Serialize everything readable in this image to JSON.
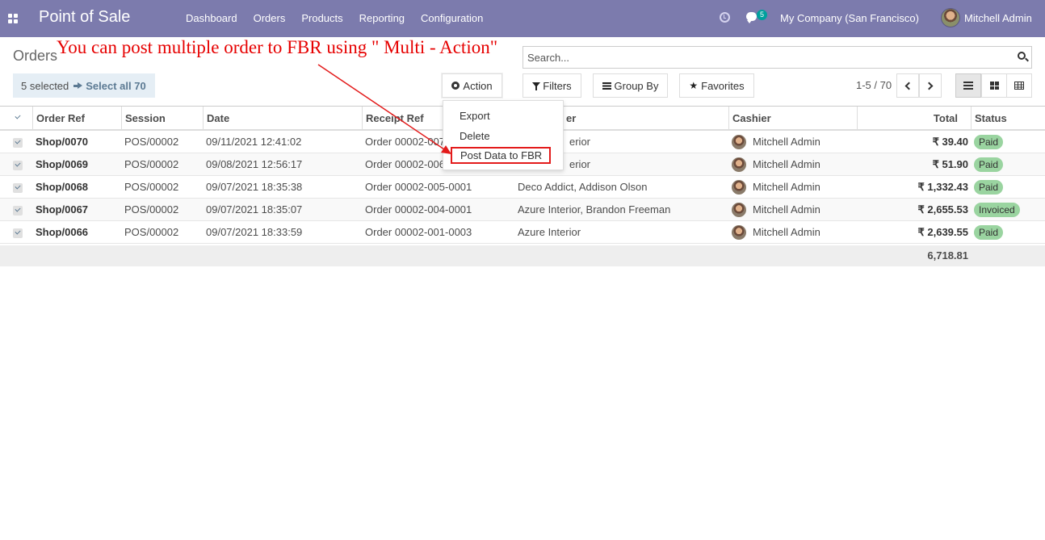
{
  "navbar": {
    "app_title": "Point of Sale",
    "menu": [
      "Dashboard",
      "Orders",
      "Products",
      "Reporting",
      "Configuration"
    ],
    "chat_count": "5",
    "company": "My Company (San Francisco)",
    "user": "Mitchell Admin"
  },
  "control_panel": {
    "breadcrumb": "Orders",
    "annotation": "You can post multiple order to FBR using \" Multi - Action\"",
    "search_placeholder": "Search...",
    "selected_text": "5 selected",
    "select_all": "Select all 70",
    "action_label": "Action",
    "filters_label": "Filters",
    "groupby_label": "Group By",
    "favorites_label": "Favorites",
    "pager": "1-5 / 70"
  },
  "action_menu": {
    "export": "Export",
    "delete": "Delete",
    "post_fbr": "Post Data to FBR"
  },
  "table": {
    "columns": {
      "order_ref": "Order Ref",
      "session": "Session",
      "date": "Date",
      "receipt_ref": "Receipt Ref",
      "customer": "er",
      "cashier": "Cashier",
      "total": "Total",
      "status": "Status"
    },
    "rows": [
      {
        "order_ref": "Shop/0070",
        "session": "POS/00002",
        "date": "09/11/2021 12:41:02",
        "receipt_ref": "Order 00002-007",
        "customer": "erior",
        "cashier": "Mitchell Admin",
        "total": "₹ 39.40",
        "status": "Paid"
      },
      {
        "order_ref": "Shop/0069",
        "session": "POS/00002",
        "date": "09/08/2021 12:56:17",
        "receipt_ref": "Order 00002-006",
        "customer": "erior",
        "cashier": "Mitchell Admin",
        "total": "₹ 51.90",
        "status": "Paid"
      },
      {
        "order_ref": "Shop/0068",
        "session": "POS/00002",
        "date": "09/07/2021 18:35:38",
        "receipt_ref": "Order 00002-005-0001",
        "customer": "Deco Addict, Addison Olson",
        "cashier": "Mitchell Admin",
        "total": "₹ 1,332.43",
        "status": "Paid"
      },
      {
        "order_ref": "Shop/0067",
        "session": "POS/00002",
        "date": "09/07/2021 18:35:07",
        "receipt_ref": "Order 00002-004-0001",
        "customer": "Azure Interior, Brandon Freeman",
        "cashier": "Mitchell Admin",
        "total": "₹ 2,655.53",
        "status": "Invoiced"
      },
      {
        "order_ref": "Shop/0066",
        "session": "POS/00002",
        "date": "09/07/2021 18:33:59",
        "receipt_ref": "Order 00002-001-0003",
        "customer": "Azure Interior",
        "cashier": "Mitchell Admin",
        "total": "₹ 2,639.55",
        "status": "Paid"
      }
    ],
    "sum_total": "6,718.81"
  },
  "colors": {
    "navbar": "#7c7bad",
    "annotation": "#e60000",
    "status_badge": "#9ad4a0"
  }
}
